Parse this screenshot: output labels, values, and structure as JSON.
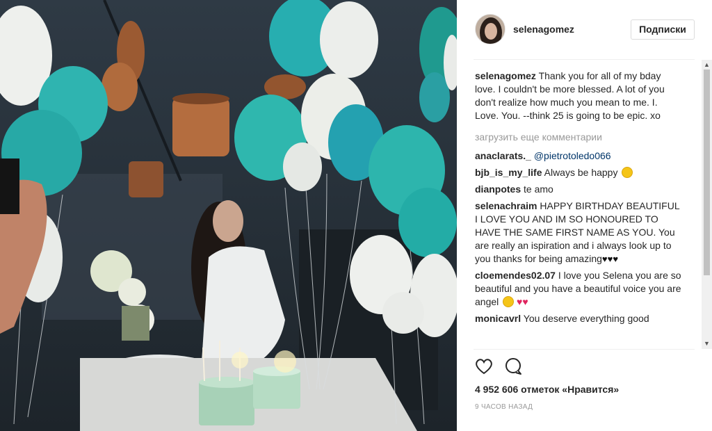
{
  "post": {
    "username": "selenagomez",
    "follow_label": "Подписки"
  },
  "caption": {
    "username": "selenagomez",
    "text": "Thank you for all of my bday love. I couldn't be more blessed. A lot of you don't realize how much you mean to me. I. Love. You. --think 25 is going to be epic. xo"
  },
  "load_more_label": "загрузить еще комментарии",
  "comments": [
    {
      "username": "anaclarats._",
      "text": "@pietrotoledo066"
    },
    {
      "username": "bjb_is_my_life",
      "text": "Always be happy"
    },
    {
      "username": "dianpotes",
      "text": "te amo"
    },
    {
      "username": "selenachraim",
      "text": "HAPPY BIRTHDAY BEAUTIFUL I LOVE YOU AND IM SO HONOURED TO HAVE THE SAME FIRST NAME AS YOU. You are really an ispiration and i always look up to you thanks for being amazing"
    },
    {
      "username": "cloemendes02.07",
      "text": "I love you Selena you are so beautiful and you have a beautiful voice you are angel"
    },
    {
      "username": "monicavrl",
      "text": "You deserve everything good"
    }
  ],
  "likes_text": "4 952 606 отметок «Нравится»",
  "timestamp": "9 ЧАСОВ НАЗАД",
  "icons": {
    "like": "heart-outline-icon",
    "comment": "speech-bubble-icon"
  },
  "colors": {
    "border": "#efefef",
    "mention": "#003569",
    "muted": "#999999",
    "balloon_teal": "#2fb4b0",
    "balloon_white": "#eef0ed"
  }
}
